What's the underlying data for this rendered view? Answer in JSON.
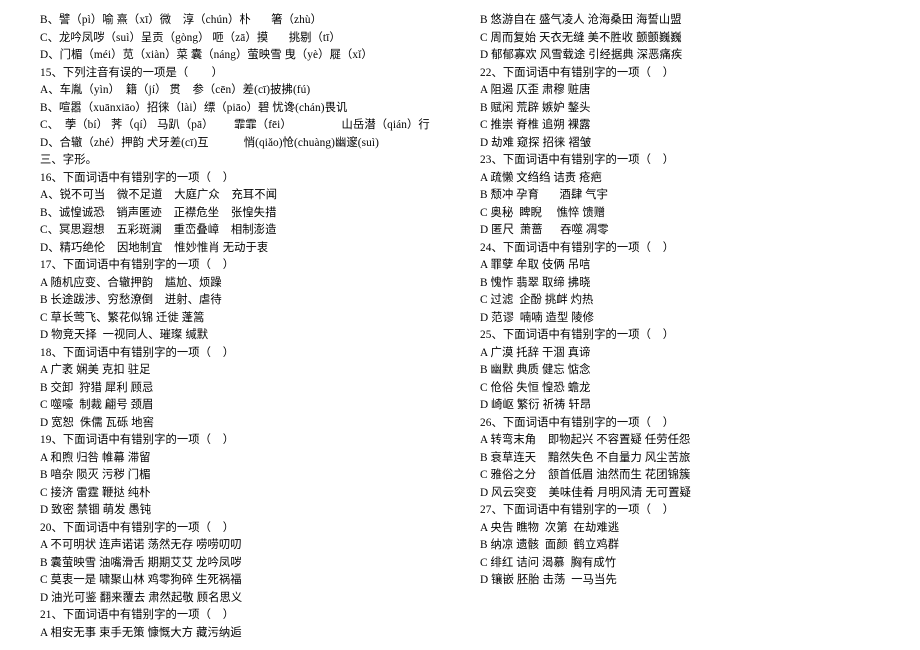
{
  "left": [
    "B、譬（pì）喻 熹（xī）微    淳（chún）朴       箸（zhù）",
    "C、龙吟凤哕（suì）呈贡（gòng） 咂（zā）摸       挑剔（tī）",
    "D、门楣（méi）苋（xiàn）菜 囊（náng）萤映雪 曳（yè）屣（xǐ）",
    "15、下列注音有误的一项是（        ）",
    "A、车胤（yìn）  籍（jí） 贯    参（cēn）差(cī)披拂(fú)",
    "B、喧嚣（xuānxiāo）招徕（lài）缥（piāo）碧 忧谗(chán)畏讥",
    "C、  荸（bí） 荠（qí） 马趴（pā）       霏霏（fēi）                 山岳潜（qián）行",
    "",
    "D、合辙（zhé）押韵 犬牙差(cī)互            悄(qiǎo)怆(chuàng)幽邃(suì)",
    "三、字形。",
    "16、下面词语中有错别字的一项（    ）",
    "A、锐不可当    微不足道    大庭广众    充耳不闻",
    "B、诚惶诚恐    销声匿迹    正襟危坐    张惶失措",
    "C、冥思遐想    五彩斑澜    重峦叠嶂    相制澎造",
    "D、精巧绝伦    因地制宜    惟妙惟肖 无动于衷",
    "17、下面词语中有错别字的一项（    ）",
    "A 随机应变、合辙押韵    尴尬、烦躁",
    "B 长途跋涉、穷愁潦倒    迸射、虐待",
    "C 草长莺飞、繁花似锦 迁徙 蓬篙",
    "D 物竞天择  一视同人、璀璨 缄默",
    "18、下面词语中有错别字的一项（    ）",
    "A 广袤 娴美 克扣 驻足",
    "B 交卸  狩猎 犀利 顾忌",
    "C 噬嚎  制裁 翩号 颈眉",
    "D 宽恕  侏儒 瓦砾 地窖",
    "19、下面词语中有错别字的一项（    ）",
    "A 和煦 归咎 帷幕 滞留",
    "B 喑杂 陨灭 污秽 门楣",
    "C 接济 雷霆 鞭挞 纯朴",
    "D 致密 禁锢 萌发 愚钝",
    "20、下面词语中有错别字的一项（    ）",
    "A 不可明状 连声诺诺 荡然无存 唠唠叨叨",
    "B 囊萤映雪 油嘴滑舌 期期艾艾 龙吟凤哕",
    "C 莫衷一是 啸聚山林 鸡零狗碎 生死祸福",
    "D 油光可鉴 翻来覆去 肃然起敬 顾名思义",
    "21、下面词语中有错别字的一项（    ）",
    "A 相安无事 束手无策 慷慨大方 藏污纳逅"
  ],
  "right": [
    "B 悠游自在 盛气凌人 沧海桑田 海誓山盟",
    "C 周而复始 天衣无缝 美不胜收 颤颤巍巍",
    "D 郁郁寡欢 风雪载途 引经据典 深恶痛疾",
    "22、下面词语中有错别字的一项（    ）",
    "A 阻遏 仄歪 肃穆 赃唐",
    "B 赋闲 荒辟 嫉妒 鏊头",
    "C 推崇 脊椎 追朔 裸露",
    "D 劫难 窥探 招徕 褶皱",
    "23、下面词语中有错别字的一项（    ）",
    "A 疏懒 文绉绉 诘责 疮疤",
    "B 颓冲 孕育       酒肆 气宇",
    "C 奥秘  睥睨     憔悴 馈赠",
    "D 匿尺  萧蔷      吞噬 凋零",
    "24、下面词语中有错别字的一项（    ）",
    "A 罪孽 牟取 伎俩 吊唁",
    "B 愧怍 翡翠 取缔 拂晓",
    "C 过滤  企酚 挑衅 灼热",
    "D 范谬  喃喃 造型 陵修",
    "25、下面词语中有错别字的一项（    ）",
    "A 广漠 托辞 干涸 真谛",
    "B 幽默 典质 健忘 惦念",
    "C 伧俗 失恒 惶恐 蟾龙",
    "D 崎岖 繁衍 祈祷 轩昂",
    "26、下面词语中有错别字的一项（    ）",
    "A 转弯末角    即物起兴 不容置疑 任劳任怨",
    "B 衰草连天    黯然失色 不自量力 风尘苦旅",
    "C 雅俗之分    颔首低眉 油然而生 花团锦簇",
    "D 风云突变    美味佳肴 月明风清 无可置疑",
    "27、下面词语中有错别字的一项（    ）",
    "A 央告 瞧物  次第  在劫难逃",
    "B 纳凉 遗骸  面颜  鹤立鸡群",
    "C 绯红 诘问 渴慕  胸有成竹",
    "D 镶嵌 胚胎 击荡  一马当先"
  ]
}
